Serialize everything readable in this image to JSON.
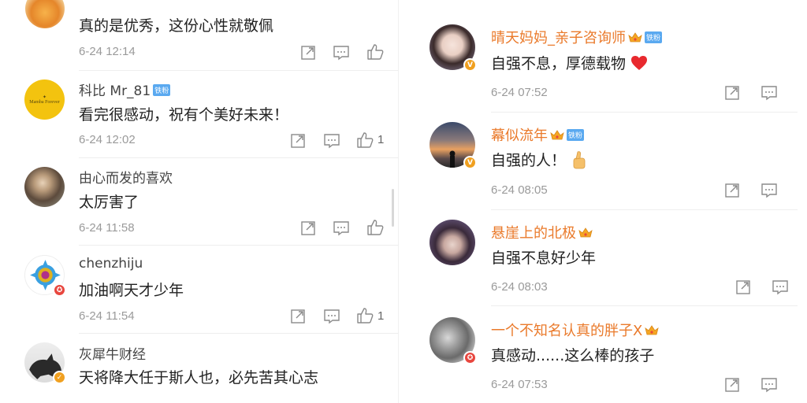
{
  "left": {
    "comments": [
      {
        "name": "",
        "text": "真的是优秀，这份心性就敬佩",
        "time": "6-24 12:14",
        "likes": ""
      },
      {
        "name": "科比 Mr_81",
        "badge": "铁粉",
        "text": "看完很感动，祝有个美好未来！",
        "time": "6-24 12:02",
        "likes": "1"
      },
      {
        "name": "由心而发的喜欢",
        "text": "太厉害了",
        "time": "6-24 11:58",
        "likes": ""
      },
      {
        "name": "chenzhiju",
        "text": "加油啊天才少年",
        "time": "6-24 11:54",
        "likes": "1"
      },
      {
        "name": "灰犀牛财经",
        "text": "天将降大任于斯人也，必先苦其心志",
        "time": "",
        "likes": ""
      }
    ],
    "avatar_logo_text": "Mamba Forever"
  },
  "right": {
    "comments": [
      {
        "name": "晴天妈妈_亲子咨询师",
        "badge": "铁粉",
        "text": "自强不息，厚德载物",
        "time": "6-24 07:52"
      },
      {
        "name": "幕似流年",
        "badge": "铁粉",
        "text": "自强的人！",
        "time": "6-24 08:05"
      },
      {
        "name": "悬崖上的北极",
        "text": "自强不息好少年",
        "time": "6-24 08:03"
      },
      {
        "name": "一个不知名认真的胖子X",
        "text": "真感动......这么棒的孩子",
        "time": "6-24 07:53"
      }
    ]
  },
  "icons": {
    "share": "share-icon",
    "comment": "comment-icon",
    "like": "thumbs-up-icon",
    "crown": "crown-badge-icon",
    "heart": "red-heart-emoji",
    "thumb_emoji": "thumbs-up-emoji"
  },
  "colors": {
    "name_orange": "#ea7a2b",
    "fan_blue": "#5aa9f0",
    "time_gray": "#9a9a9a"
  }
}
